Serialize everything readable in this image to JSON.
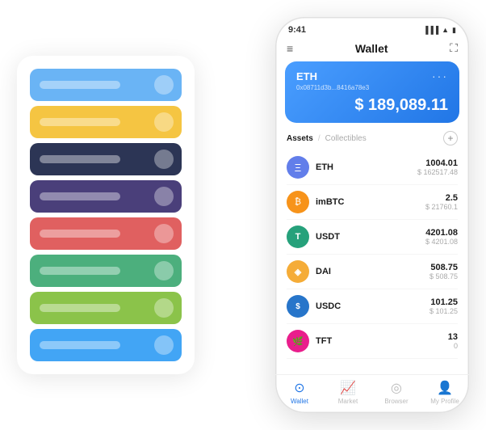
{
  "phone": {
    "time": "9:41",
    "header_title": "Wallet",
    "eth_card": {
      "name": "ETH",
      "address": "0x08711d3b...8416a78e3",
      "balance": "$ 189,089.11",
      "balance_symbol": "$"
    },
    "assets_tab": "Assets",
    "collectibles_tab": "Collectibles",
    "add_button": "+",
    "assets": [
      {
        "symbol": "ETH",
        "amount": "1004.01",
        "usd": "$ 162517.48",
        "icon": "Ξ",
        "color": "#627eea"
      },
      {
        "symbol": "imBTC",
        "amount": "2.5",
        "usd": "$ 21760.1",
        "icon": "₿",
        "color": "#f7931a"
      },
      {
        "symbol": "USDT",
        "amount": "4201.08",
        "usd": "$ 4201.08",
        "icon": "₮",
        "color": "#26a17b"
      },
      {
        "symbol": "DAI",
        "amount": "508.75",
        "usd": "$ 508.75",
        "icon": "◈",
        "color": "#f5ac37"
      },
      {
        "symbol": "USDC",
        "amount": "101.25",
        "usd": "$ 101.25",
        "icon": "©",
        "color": "#2775ca"
      },
      {
        "symbol": "TFT",
        "amount": "13",
        "usd": "0",
        "icon": "🌿",
        "color": "#e91e8c"
      }
    ],
    "nav": [
      {
        "label": "Wallet",
        "active": true,
        "icon": "○"
      },
      {
        "label": "Market",
        "active": false,
        "icon": "↗"
      },
      {
        "label": "Browser",
        "active": false,
        "icon": "⊙"
      },
      {
        "label": "My Profile",
        "active": false,
        "icon": "⊕"
      }
    ]
  },
  "card_stack": {
    "cards": [
      {
        "color": "c1"
      },
      {
        "color": "c2"
      },
      {
        "color": "c3"
      },
      {
        "color": "c4"
      },
      {
        "color": "c5"
      },
      {
        "color": "c6"
      },
      {
        "color": "c7"
      },
      {
        "color": "c8"
      }
    ]
  }
}
